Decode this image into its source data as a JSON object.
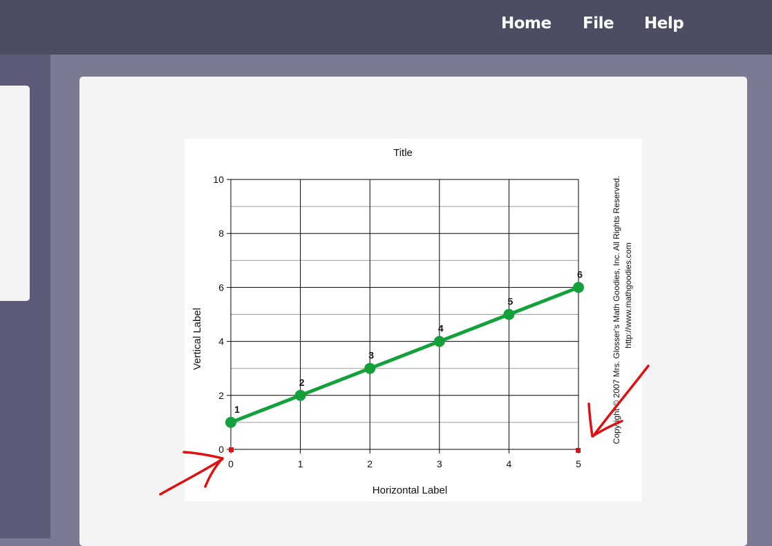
{
  "nav": {
    "home": "Home",
    "file": "File",
    "help": "Help"
  },
  "chart_data": {
    "type": "line",
    "title": "Title",
    "xlabel": "Horizontal Label",
    "ylabel": "Vertical Label",
    "xlim": [
      0,
      5
    ],
    "ylim": [
      0,
      10
    ],
    "x_ticks": [
      "0",
      "1",
      "2",
      "3",
      "4",
      "5"
    ],
    "y_ticks": [
      "0",
      "2",
      "4",
      "6",
      "8",
      "10"
    ],
    "grid": true,
    "series": [
      {
        "x": [
          0,
          1,
          2,
          3,
          4,
          5
        ],
        "values": [
          1,
          2,
          3,
          4,
          5,
          6
        ],
        "point_labels": [
          "1",
          "2",
          "3",
          "4",
          "5",
          "6"
        ]
      }
    ],
    "copyright_line1": "Copyright © 2007 Mrs. Glosser's Math Goodies, Inc.  All Rights Reserved.",
    "copyright_line2": "http://www.mathgoodies.com"
  },
  "colors": {
    "series": "#14a03a",
    "annotation": "#e01010",
    "topbar": "#4b4d62"
  }
}
